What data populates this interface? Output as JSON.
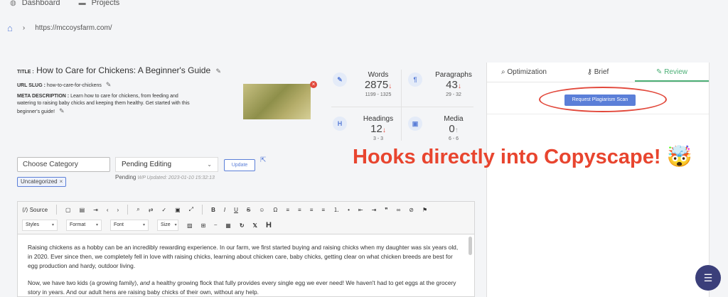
{
  "nav": {
    "dashboard": "Dashboard",
    "projects": "Projects"
  },
  "breadcrumb": {
    "url": "https://mccoysfarm.com/"
  },
  "article": {
    "title_label": "TITLE :",
    "title": "How to Care for Chickens: A Beginner's Guide",
    "slug_label": "URL SLUG :",
    "slug": "how-to-care-for-chickens",
    "meta_label": "META DESCRIPTION :",
    "meta": "Learn how to care for chickens, from feeding and watering to raising baby chicks and keeping them healthy. Get started with this beginner's guide!"
  },
  "stats": {
    "words": {
      "label": "Words",
      "value": "2875",
      "range": "1199 - 1325",
      "trend": "↓"
    },
    "paragraphs": {
      "label": "Paragraphs",
      "value": "43",
      "range": "29 - 32",
      "trend": "↓"
    },
    "headings": {
      "label": "Headings",
      "value": "12",
      "range": "3 - 3",
      "trend": "↓"
    },
    "media": {
      "label": "Media",
      "value": "0",
      "range": "6 - 6",
      "trend": "↑"
    }
  },
  "panel": {
    "tabs": [
      "Optimization",
      "Brief",
      "Review"
    ],
    "scan_button": "Request Plagiarism Scan"
  },
  "annotation": "Hooks directly into Copyscape! 🤯",
  "form": {
    "category_placeholder": "Choose Category",
    "status": "Pending Editing",
    "update": "Update",
    "pending_status": "Pending",
    "wp_updated": "WP Updated: 2023-01-10 15:32:13",
    "tag": "Uncategorized"
  },
  "toolbar": {
    "source": "Source",
    "styles": "Styles",
    "format": "Format",
    "font": "Font",
    "size": "Size"
  },
  "content": {
    "p1": "Raising chickens as a hobby can be an incredibly rewarding experience. In our farm, we first started buying and raising chicks when my daughter was six years old, in 2020. Ever since then, we completely fell in love with raising chicks, learning about chicken care, baby chicks, getting clear on what chicken breeds are best for egg production and hardy, outdoor living.",
    "p2a": "Now, we have two kids (a growing family), ",
    "p2b": "and",
    "p2c": " a healthy growing flock that fully provides every single egg we ever need! We haven't had to get eggs at the grocery story in years. And our adult hens are raising baby chicks of their own, without any help."
  },
  "colors": {
    "accent": "#5b7fd8",
    "active_tab": "#4caf76",
    "alert": "#e2493c",
    "annotation": "#e8452f"
  }
}
